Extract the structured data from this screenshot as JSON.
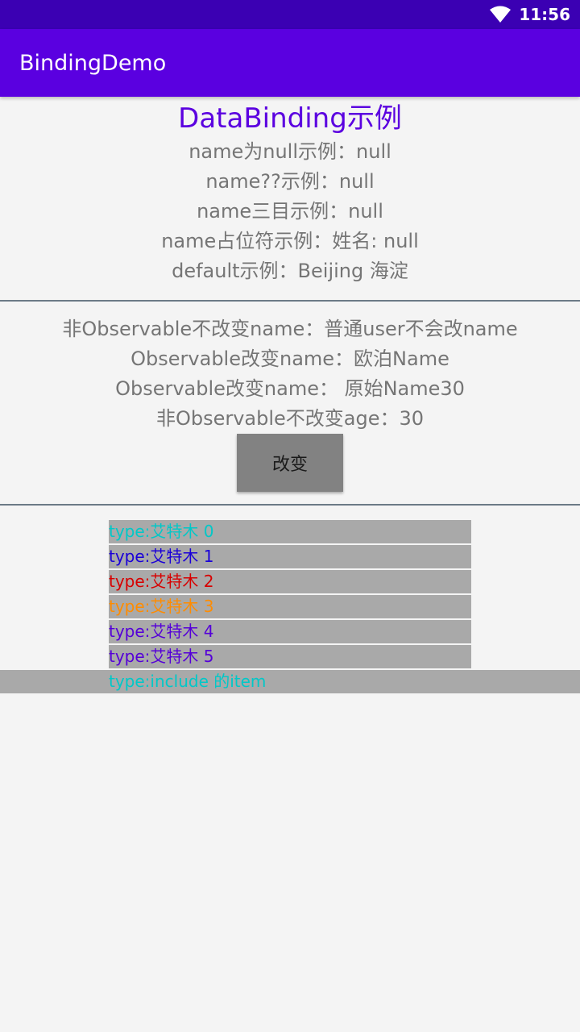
{
  "status_bar": {
    "time": "11:56",
    "icons": [
      "wifi-icon"
    ]
  },
  "app_bar": {
    "title": "BindingDemo"
  },
  "section1": {
    "title": "DataBinding示例",
    "lines": [
      "name为null示例：null",
      "name??示例：null",
      "name三目示例：null",
      "name占位符示例：姓名: null",
      "default示例：Beijing 海淀"
    ]
  },
  "section2": {
    "lines": [
      "非Observable不改变name：普通user不会改name",
      "Observable改变name：欧泊Name",
      "Observable改变name： 原始Name30",
      "非Observable不改变age：30"
    ],
    "button_label": "改变"
  },
  "list": {
    "items": [
      {
        "text": "type:艾特木 0",
        "color": "#00c8c8"
      },
      {
        "text": "type:艾特木 1",
        "color": "#1a00d8"
      },
      {
        "text": "type:艾特木 2",
        "color": "#d80000"
      },
      {
        "text": "type:艾特木 3",
        "color": "#ff8c00"
      },
      {
        "text": "type:艾特木 4",
        "color": "#5500d8"
      },
      {
        "text": "type:艾特木 5",
        "color": "#5500d8"
      }
    ],
    "include_item": {
      "text": "type:include 的item",
      "color": "#00c8c8"
    }
  },
  "colors": {
    "status_bar": "#3b00b3",
    "app_bar": "#5a00e0",
    "accent_title": "#5b00e0",
    "item_background": "#a9a9a9"
  }
}
